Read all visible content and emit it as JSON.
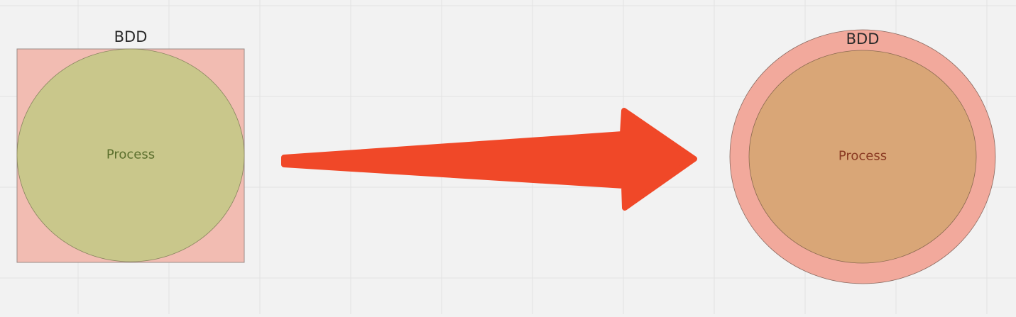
{
  "colors": {
    "background": "#f2f2f2",
    "grid": "#e2e2e2",
    "outer_fill": "#f2bcb2",
    "inner_fill_left": "#c9c78b",
    "outer_fill_right": "#f2a99c",
    "inner_fill_right": "#d9a677",
    "arrow": "#f04828",
    "stroke": "#8a6a60"
  },
  "before": {
    "container_label": "BDD",
    "inner_label": "Process"
  },
  "after": {
    "container_label": "BDD",
    "inner_label": "Process"
  }
}
